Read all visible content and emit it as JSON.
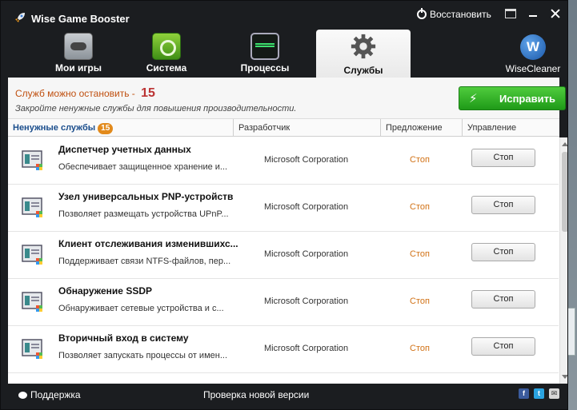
{
  "window": {
    "title": "Wise Game Booster",
    "restore_label": "Восстановить"
  },
  "nav": {
    "tabs": [
      {
        "label": "Мои игры",
        "icon": "gamepad-icon"
      },
      {
        "label": "Система",
        "icon": "system-gauge-icon"
      },
      {
        "label": "Процессы",
        "icon": "monitor-pulse-icon"
      },
      {
        "label": "Службы",
        "icon": "gear-icon"
      }
    ],
    "active_tab": "Службы",
    "brand": {
      "logo_letter": "W",
      "label": "WiseCleaner"
    }
  },
  "summary": {
    "stoppable_label": "Служб можно остановить -",
    "stoppable_count": "15",
    "hint": "Закройте ненужные службы для повышения производительности.",
    "fix_button_label": "Исправить"
  },
  "columns": {
    "name": "Ненужные службы",
    "name_badge": "15",
    "developer": "Разработчик",
    "suggestion": "Предложение",
    "control": "Управление"
  },
  "services": [
    {
      "title": "Диспетчер учетных данных",
      "description": "Обеспечивает защищенное хранение и...",
      "developer": "Microsoft Corporation",
      "suggestion": "Стоп",
      "action": "Стоп"
    },
    {
      "title": "Узел универсальных PNP-устройств",
      "description": "Позволяет размещать устройства UPnP...",
      "developer": "Microsoft Corporation",
      "suggestion": "Стоп",
      "action": "Стоп"
    },
    {
      "title": "Клиент отслеживания изменившихс...",
      "description": "Поддерживает связи NTFS-файлов, пер...",
      "developer": "Microsoft Corporation",
      "suggestion": "Стоп",
      "action": "Стоп"
    },
    {
      "title": "Обнаружение SSDP",
      "description": "Обнаруживает сетевые устройства и с...",
      "developer": "Microsoft Corporation",
      "suggestion": "Стоп",
      "action": "Стоп"
    },
    {
      "title": "Вторичный вход в систему",
      "description": "Позволяет запускать процессы от имен...",
      "developer": "Microsoft Corporation",
      "suggestion": "Стоп",
      "action": "Стоп"
    }
  ],
  "footer": {
    "support_label": "Поддержка",
    "update_label": "Проверка новой версии",
    "social": [
      "f",
      "t",
      "✉"
    ]
  },
  "colors": {
    "accent_green": "#2bb024",
    "suggestion_orange": "#d27318",
    "count_red": "#b33333",
    "window_dark": "#1b1d20"
  }
}
